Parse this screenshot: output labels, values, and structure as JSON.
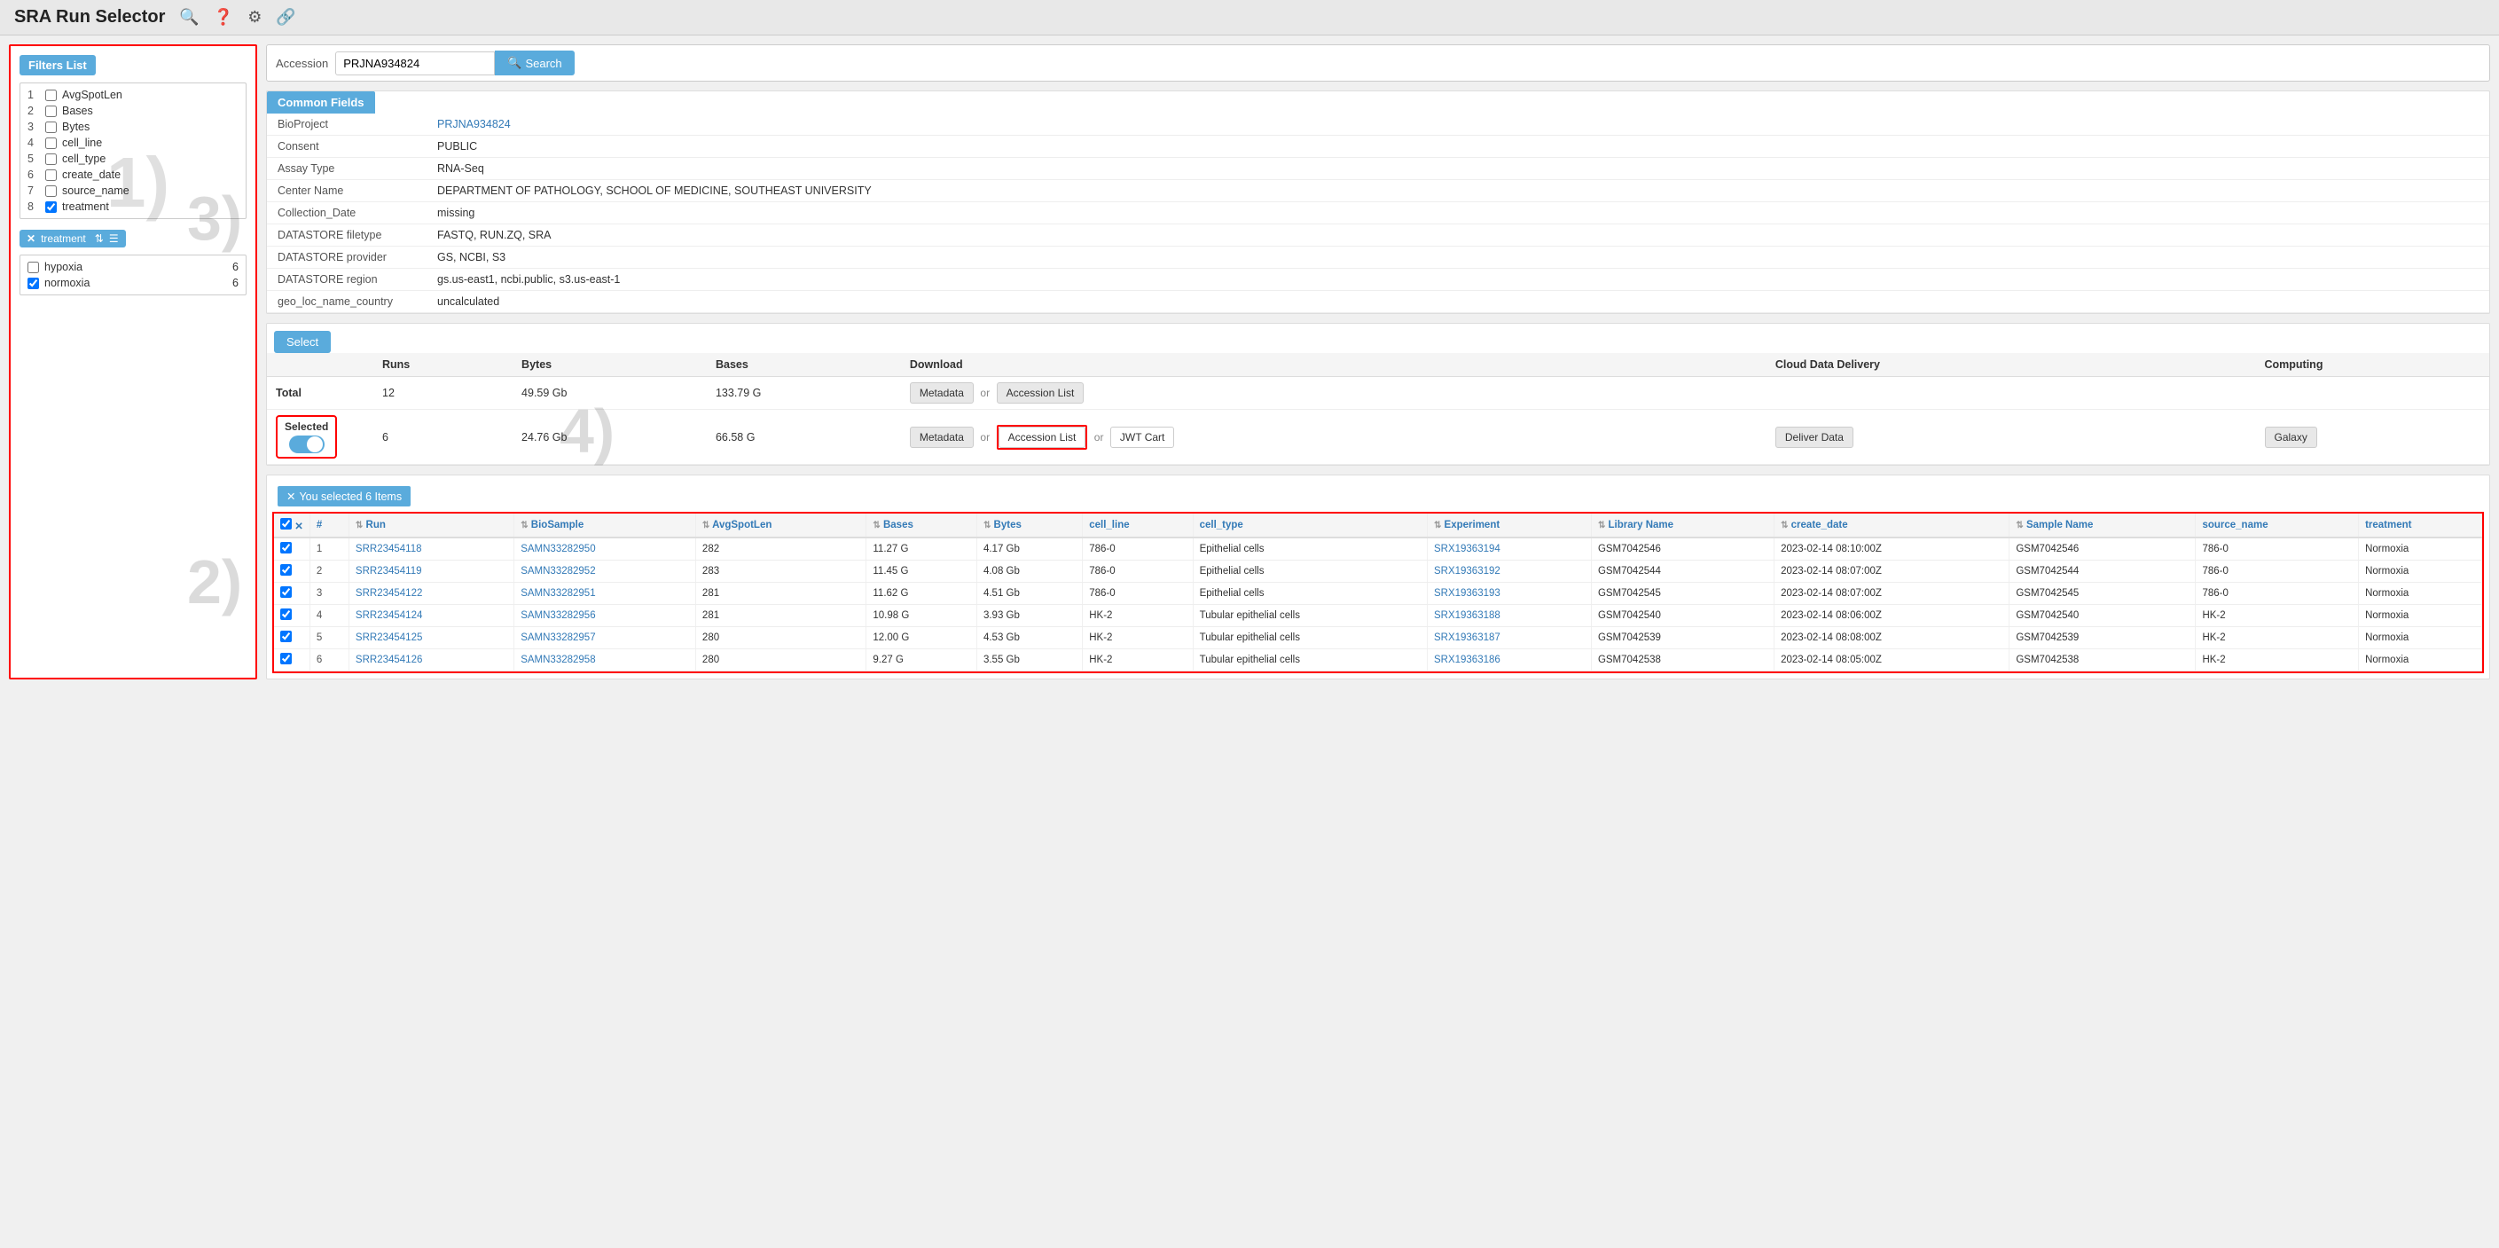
{
  "app": {
    "title": "SRA Run Selector"
  },
  "navbar": {
    "icons": [
      "search",
      "help",
      "settings",
      "link"
    ]
  },
  "search": {
    "label": "Accession",
    "value": "PRJNA934824",
    "button_label": "Search"
  },
  "common_fields": {
    "header": "Common Fields",
    "rows": [
      {
        "key": "BioProject",
        "value": "PRJNA934824",
        "is_link": true
      },
      {
        "key": "Consent",
        "value": "PUBLIC"
      },
      {
        "key": "Assay Type",
        "value": "RNA-Seq"
      },
      {
        "key": "Center Name",
        "value": "DEPARTMENT OF PATHOLOGY, SCHOOL OF MEDICINE, SOUTHEAST UNIVERSITY"
      },
      {
        "key": "Collection_Date",
        "value": "missing"
      },
      {
        "key": "DATASTORE filetype",
        "value": "FASTQ, RUN.ZQ, SRA"
      },
      {
        "key": "DATASTORE provider",
        "value": "GS, NCBI, S3"
      },
      {
        "key": "DATASTORE region",
        "value": "gs.us-east1, ncbi.public, s3.us-east-1"
      },
      {
        "key": "geo_loc_name_country",
        "value": "uncalculated"
      }
    ]
  },
  "filters": {
    "header": "Filters List",
    "items": [
      {
        "num": 1,
        "label": "AvgSpotLen",
        "checked": false
      },
      {
        "num": 2,
        "label": "Bases",
        "checked": false
      },
      {
        "num": 3,
        "label": "Bytes",
        "checked": false
      },
      {
        "num": 4,
        "label": "cell_line",
        "checked": false
      },
      {
        "num": 5,
        "label": "cell_type",
        "checked": false
      },
      {
        "num": 6,
        "label": "create_date",
        "checked": false
      },
      {
        "num": 7,
        "label": "source_name",
        "checked": false
      },
      {
        "num": 8,
        "label": "treatment",
        "checked": true
      }
    ],
    "active_filter": {
      "label": "treatment",
      "values": [
        {
          "label": "hypoxia",
          "count": 6,
          "checked": false
        },
        {
          "label": "normoxia",
          "count": 6,
          "checked": true
        }
      ]
    }
  },
  "select_section": {
    "button_label": "Select",
    "columns": {
      "runs": "Runs",
      "bytes": "Bytes",
      "bases": "Bases",
      "download": "Download",
      "cloud_delivery": "Cloud Data Delivery",
      "computing": "Computing"
    },
    "total_row": {
      "label": "Total",
      "runs": 12,
      "bytes": "49.59 Gb",
      "bases": "133.79 G",
      "metadata_btn": "Metadata",
      "accession_btn": "Accession List"
    },
    "selected_row": {
      "label": "Selected",
      "runs": 6,
      "bytes": "24.76 Gb",
      "bases": "66.58 G",
      "metadata_btn": "Metadata",
      "accession_btn": "Accession List",
      "jwt_btn": "JWT Cart",
      "deliver_btn": "Deliver Data",
      "galaxy_btn": "Galaxy"
    }
  },
  "data_table": {
    "selected_count": "You selected 6 Items",
    "columns": [
      "Run",
      "BioSample",
      "AvgSpotLen",
      "Bases",
      "Bytes",
      "cell_line",
      "cell_type",
      "Experiment",
      "Library Name",
      "create_date",
      "Sample Name",
      "source_name",
      "treatment"
    ],
    "rows": [
      {
        "num": 1,
        "checked": true,
        "run": "SRR23454118",
        "biosample": "SAMN33282950",
        "avgspotlen": 282,
        "bases": "11.27 G",
        "bytes": "4.17 Gb",
        "cell_line": "786-0",
        "cell_type": "Epithelial cells",
        "experiment": "SRX19363194",
        "library_name": "GSM7042546",
        "create_date": "2023-02-14 08:10:00Z",
        "sample_name": "GSM7042546",
        "source_name": "786-0",
        "treatment": "Normoxia"
      },
      {
        "num": 2,
        "checked": true,
        "run": "SRR23454119",
        "biosample": "SAMN33282952",
        "avgspotlen": 283,
        "bases": "11.45 G",
        "bytes": "4.08 Gb",
        "cell_line": "786-0",
        "cell_type": "Epithelial cells",
        "experiment": "SRX19363192",
        "library_name": "GSM7042544",
        "create_date": "2023-02-14 08:07:00Z",
        "sample_name": "GSM7042544",
        "source_name": "786-0",
        "treatment": "Normoxia"
      },
      {
        "num": 3,
        "checked": true,
        "run": "SRR23454122",
        "biosample": "SAMN33282951",
        "avgspotlen": 281,
        "bases": "11.62 G",
        "bytes": "4.51 Gb",
        "cell_line": "786-0",
        "cell_type": "Epithelial cells",
        "experiment": "SRX19363193",
        "library_name": "GSM7042545",
        "create_date": "2023-02-14 08:07:00Z",
        "sample_name": "GSM7042545",
        "source_name": "786-0",
        "treatment": "Normoxia"
      },
      {
        "num": 4,
        "checked": true,
        "run": "SRR23454124",
        "biosample": "SAMN33282956",
        "avgspotlen": 281,
        "bases": "10.98 G",
        "bytes": "3.93 Gb",
        "cell_line": "HK-2",
        "cell_type": "Tubular epithelial cells",
        "experiment": "SRX19363188",
        "library_name": "GSM7042540",
        "create_date": "2023-02-14 08:06:00Z",
        "sample_name": "GSM7042540",
        "source_name": "HK-2",
        "treatment": "Normoxia"
      },
      {
        "num": 5,
        "checked": true,
        "run": "SRR23454125",
        "biosample": "SAMN33282957",
        "avgspotlen": 280,
        "bases": "12.00 G",
        "bytes": "4.53 Gb",
        "cell_line": "HK-2",
        "cell_type": "Tubular epithelial cells",
        "experiment": "SRX19363187",
        "library_name": "GSM7042539",
        "create_date": "2023-02-14 08:08:00Z",
        "sample_name": "GSM7042539",
        "source_name": "HK-2",
        "treatment": "Normoxia"
      },
      {
        "num": 6,
        "checked": true,
        "run": "SRR23454126",
        "biosample": "SAMN33282958",
        "avgspotlen": 280,
        "bases": "9.27 G",
        "bytes": "3.55 Gb",
        "cell_line": "HK-2",
        "cell_type": "Tubular epithelial cells",
        "experiment": "SRX19363186",
        "library_name": "GSM7042538",
        "create_date": "2023-02-14 08:05:00Z",
        "sample_name": "GSM7042538",
        "source_name": "HK-2",
        "treatment": "Normoxia"
      }
    ]
  },
  "annotation_labels": [
    "1)",
    "2)",
    "3)",
    "4)"
  ]
}
